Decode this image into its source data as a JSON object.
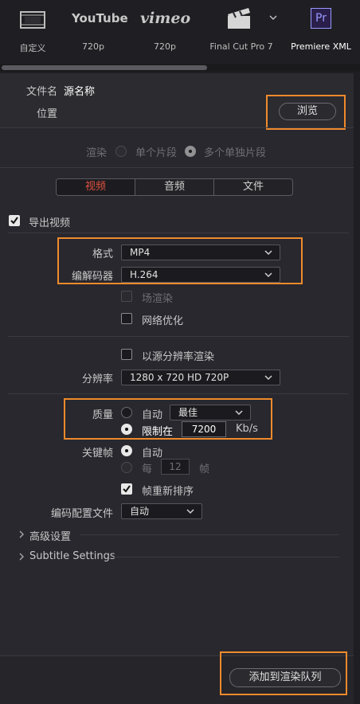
{
  "presets": [
    {
      "caption": "自定义",
      "icon": "film-strip-icon"
    },
    {
      "caption": "720p",
      "icon": "youtube-logo",
      "logo_text": "YouTube"
    },
    {
      "caption": "720p",
      "icon": "vimeo-logo",
      "logo_text": "vimeo"
    },
    {
      "caption": "Final Cut Pro 7",
      "icon": "clapperboard-icon"
    },
    {
      "caption": "Premiere XML",
      "icon": "premiere-logo",
      "logo_text": "Pr"
    }
  ],
  "file": {
    "filename_label": "文件名",
    "filename_value": "源名称",
    "location_label": "位置",
    "browse_label": "浏览"
  },
  "render": {
    "label": "渲染",
    "option_single": "单个片段",
    "option_multi": "多个单独片段",
    "selected": "多个单独片段"
  },
  "tabs": [
    "视频",
    "音频",
    "文件"
  ],
  "active_tab": "视频",
  "video": {
    "export_video_label": "导出视频",
    "export_video_checked": true,
    "format_label": "格式",
    "format_value": "MP4",
    "codec_label": "编解码器",
    "codec_value": "H.264",
    "field_render_label": "场渲染",
    "network_opt_label": "网络优化",
    "source_res_label": "以源分辨率渲染",
    "resolution_label": "分辨率",
    "resolution_value": "1280 x 720 HD 720P",
    "quality_label": "质量",
    "quality_auto_label": "自动",
    "quality_auto_value": "最佳",
    "quality_limit_label": "限制在",
    "quality_limit_value": "7200",
    "quality_unit": "Kb/s",
    "keyframe_label": "关键帧",
    "keyframe_auto_label": "自动",
    "keyframe_every_label": "每",
    "keyframe_every_value": "12",
    "keyframe_unit": "帧",
    "frame_reorder_label": "帧重新排序",
    "frame_reorder_checked": true,
    "encode_profile_label": "编码配置文件",
    "encode_profile_value": "自动"
  },
  "sections": {
    "advanced": "高级设置",
    "subtitle": "Subtitle Settings"
  },
  "footer": {
    "add_button_label": "添加到渲染队列"
  },
  "colors": {
    "highlight": "#f08a2c",
    "active_tab": "#e05040",
    "premiere": "#9999ff"
  }
}
